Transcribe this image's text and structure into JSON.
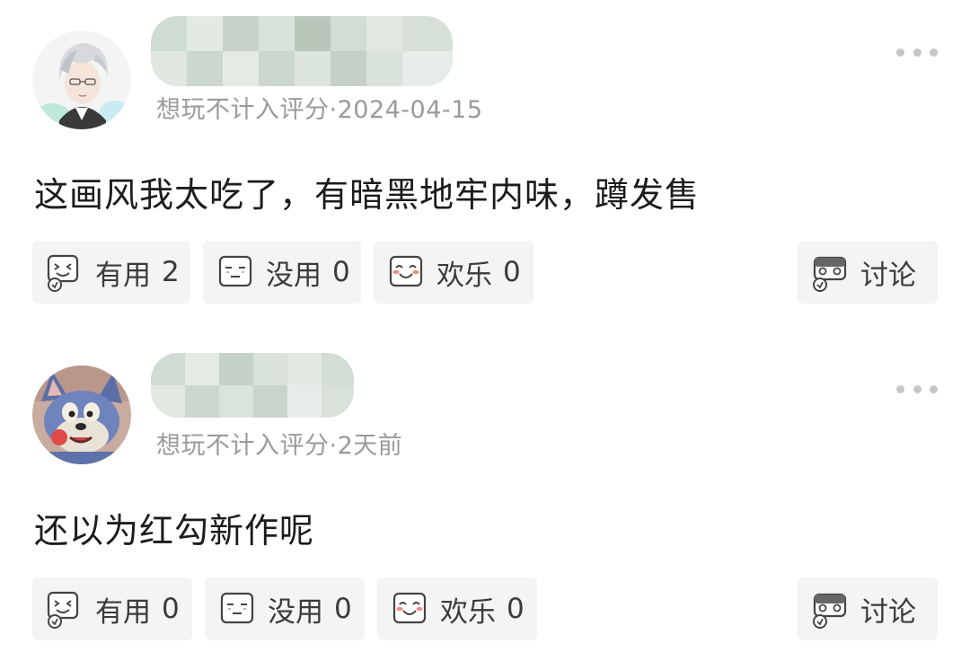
{
  "comments": [
    {
      "meta": "想玩不计入评分·2024-04-15",
      "text": "这画风我太吃了，有暗黑地牢内味，蹲发售",
      "reactions": {
        "useful": {
          "label": "有用",
          "count": "2"
        },
        "useless": {
          "label": "没用",
          "count": "0"
        },
        "happy": {
          "label": "欢乐",
          "count": "0"
        }
      },
      "discuss_label": "讨论"
    },
    {
      "meta": "想玩不计入评分·2天前",
      "text": "还以为红勾新作呢",
      "reactions": {
        "useful": {
          "label": "有用",
          "count": "0"
        },
        "useless": {
          "label": "没用",
          "count": "0"
        },
        "happy": {
          "label": "欢乐",
          "count": "0"
        }
      },
      "discuss_label": "讨论"
    }
  ]
}
